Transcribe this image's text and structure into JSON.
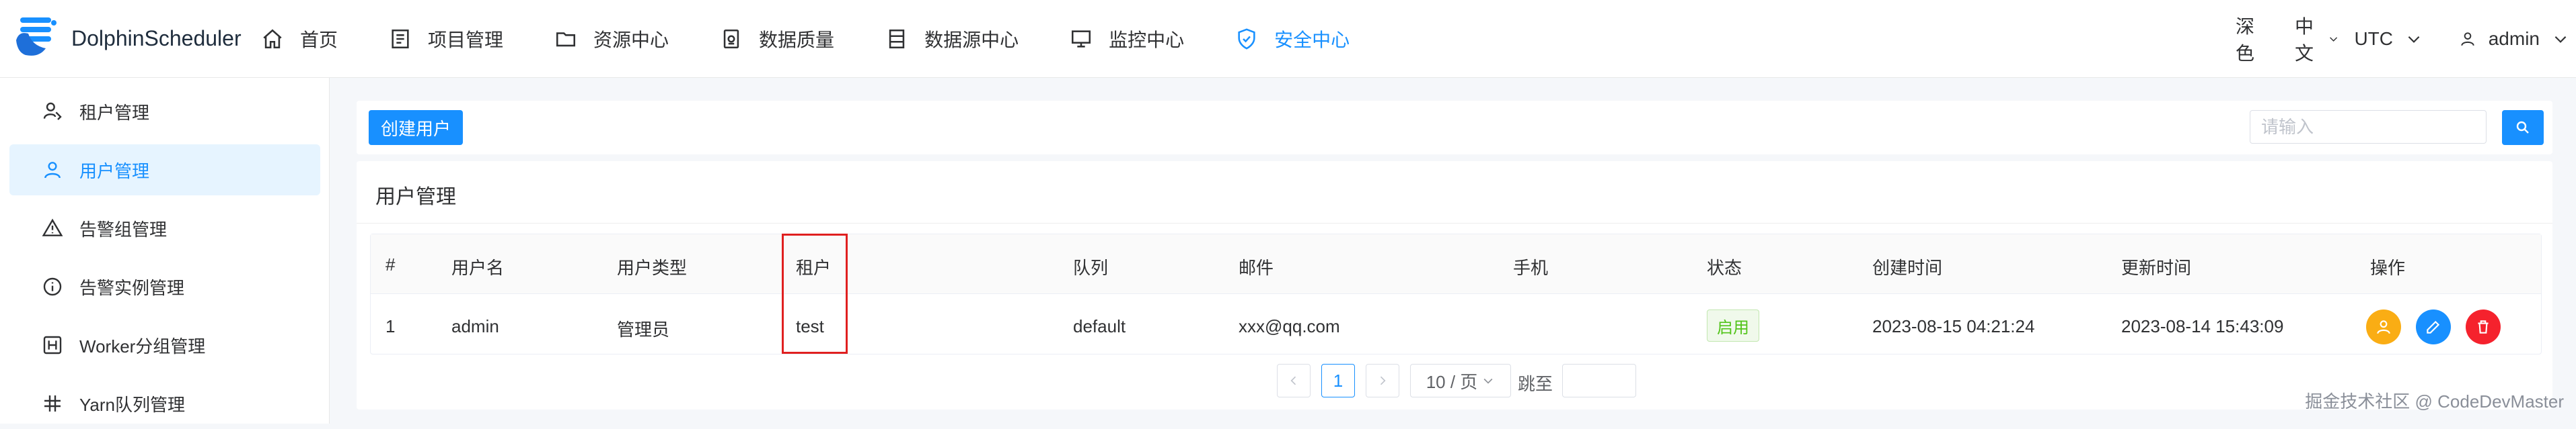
{
  "app": {
    "name": "DolphinScheduler"
  },
  "nav": {
    "items": [
      {
        "label": "首页",
        "icon": "home-icon"
      },
      {
        "label": "项目管理",
        "icon": "project-icon"
      },
      {
        "label": "资源中心",
        "icon": "folder-icon"
      },
      {
        "label": "数据质量",
        "icon": "data-quality-icon"
      },
      {
        "label": "数据源中心",
        "icon": "datasource-icon"
      },
      {
        "label": "监控中心",
        "icon": "monitor-icon"
      },
      {
        "label": "安全中心",
        "icon": "shield-icon",
        "active": true
      }
    ]
  },
  "header_right": {
    "theme": "深色",
    "language": "中文",
    "timezone": "UTC",
    "user": "admin"
  },
  "sidebar": {
    "items": [
      {
        "label": "租户管理",
        "icon": "tenant-icon"
      },
      {
        "label": "用户管理",
        "icon": "user-icon",
        "active": true
      },
      {
        "label": "告警组管理",
        "icon": "warning-icon"
      },
      {
        "label": "告警实例管理",
        "icon": "info-icon"
      },
      {
        "label": "Worker分组管理",
        "icon": "worker-group-icon"
      },
      {
        "label": "Yarn队列管理",
        "icon": "yarn-queue-icon"
      }
    ]
  },
  "toolbar": {
    "create_label": "创建用户",
    "search_placeholder": "请输入"
  },
  "table": {
    "title": "用户管理",
    "columns": [
      "#",
      "用户名",
      "用户类型",
      "租户",
      "队列",
      "邮件",
      "手机",
      "状态",
      "创建时间",
      "更新时间",
      "操作"
    ],
    "rows": [
      {
        "index": "1",
        "username": "admin",
        "user_type": "管理员",
        "tenant": "test",
        "queue": "default",
        "email": "xxx@qq.com",
        "phone": "",
        "status": "启用",
        "created": "2023-08-15 04:21:24",
        "updated": "2023-08-14 15:43:09"
      }
    ]
  },
  "pagination": {
    "current": "1",
    "page_size": "10 / 页",
    "jump_label": "跳至"
  },
  "watermark": "掘金技术社区 @ CodeDevMaster",
  "colors": {
    "primary": "#1890ff",
    "success": "#52c41a",
    "warning": "#faad14",
    "danger": "#f5222d",
    "highlight": "#e02020"
  }
}
